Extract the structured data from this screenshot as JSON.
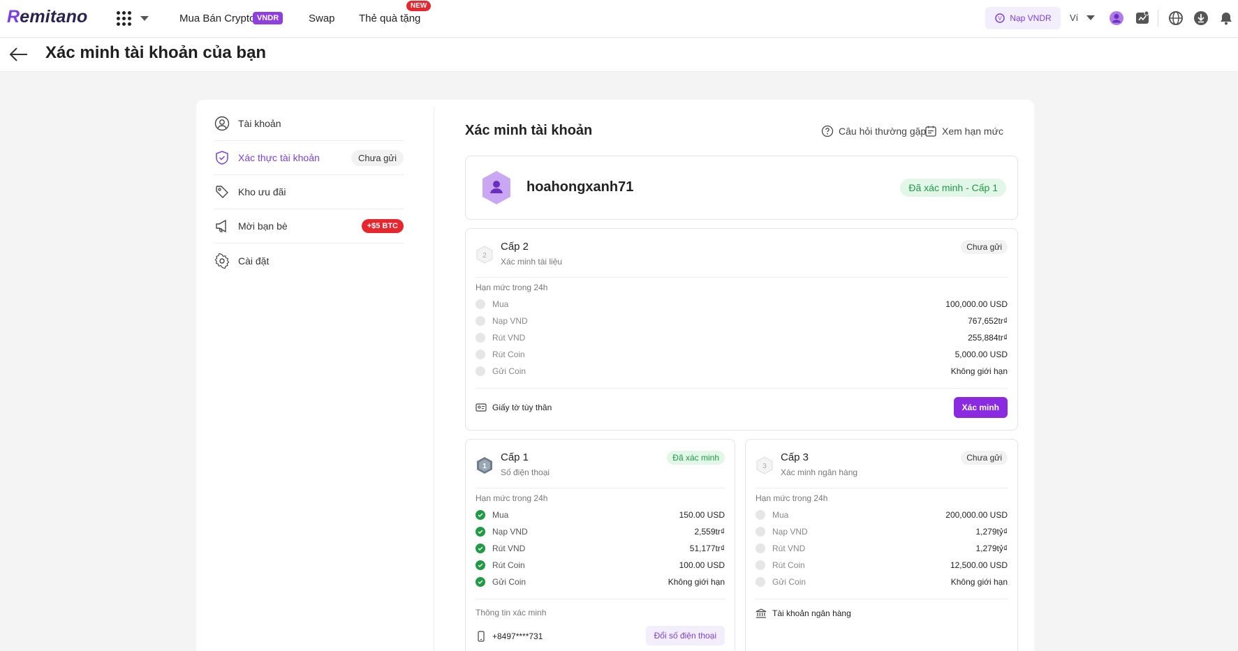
{
  "topbar": {
    "logo": "Remitano",
    "nav": {
      "buy_sell": "Mua Bán Crypto",
      "buy_sell_badge": "VNDR",
      "swap": "Swap",
      "gift": "Thẻ quà tặng",
      "gift_badge": "NEW"
    },
    "deposit_button": "Nạp VNDR",
    "wallet": "Ví"
  },
  "page": {
    "title": "Xác minh tài khoản của bạn"
  },
  "sidebar": {
    "items": [
      {
        "label": "Tài khoản"
      },
      {
        "label": "Xác thực tài khoản",
        "badge": "Chưa gửi"
      },
      {
        "label": "Kho ưu đãi"
      },
      {
        "label": "Mời bạn bè",
        "badge": "+$5 BTC"
      },
      {
        "label": "Cài đặt"
      }
    ]
  },
  "content": {
    "title": "Xác minh tài khoản",
    "faq_link": "Câu hỏi thường gặp",
    "limits_link": "Xem hạn mức",
    "user": {
      "username": "hoahongxanh71",
      "status": "Đã xác minh - Cấp 1"
    }
  },
  "tiers": {
    "level2": {
      "title": "Cấp 2",
      "subtitle": "Xác minh tài liệu",
      "status": "Chưa gửi",
      "limits_title": "Hạn mức trong 24h",
      "rows": [
        {
          "label": "Mua",
          "value": "100,000.00 USD"
        },
        {
          "label": "Nạp VND",
          "value": "767,652tr₫"
        },
        {
          "label": "Rút VND",
          "value": "255,884tr₫"
        },
        {
          "label": "Rút Coin",
          "value": "5,000.00 USD"
        },
        {
          "label": "Gửi Coin",
          "value": "Không giới hạn"
        }
      ],
      "footer_label": "Giấy tờ tùy thân",
      "action": "Xác minh"
    },
    "level1": {
      "title": "Cấp 1",
      "subtitle": "Số điện thoại",
      "status": "Đã xác minh",
      "limits_title": "Hạn mức trong 24h",
      "rows": [
        {
          "label": "Mua",
          "value": "150.00 USD"
        },
        {
          "label": "Nạp VND",
          "value": "2,559tr₫"
        },
        {
          "label": "Rút VND",
          "value": "51,177tr₫"
        },
        {
          "label": "Rút Coin",
          "value": "100.00 USD"
        },
        {
          "label": "Gửi Coin",
          "value": "Không giới hạn"
        }
      ],
      "info_title": "Thông tin xác minh",
      "phone": "+8497****731",
      "action": "Đổi số điện thoại"
    },
    "level3": {
      "title": "Cấp 3",
      "subtitle": "Xác minh ngân hàng",
      "status": "Chưa gửi",
      "limits_title": "Hạn mức trong 24h",
      "rows": [
        {
          "label": "Mua",
          "value": "200,000.00 USD"
        },
        {
          "label": "Nạp VND",
          "value": "1,279tỷ₫"
        },
        {
          "label": "Rút VND",
          "value": "1,279tỷ₫"
        },
        {
          "label": "Rút Coin",
          "value": "12,500.00 USD"
        },
        {
          "label": "Gửi Coin",
          "value": "Không giới hạn"
        }
      ],
      "footer_label": "Tài khoản ngân hàng"
    }
  },
  "colors": {
    "accent": "#8a2be2",
    "success": "#1f9a45",
    "danger": "#e8262d"
  }
}
